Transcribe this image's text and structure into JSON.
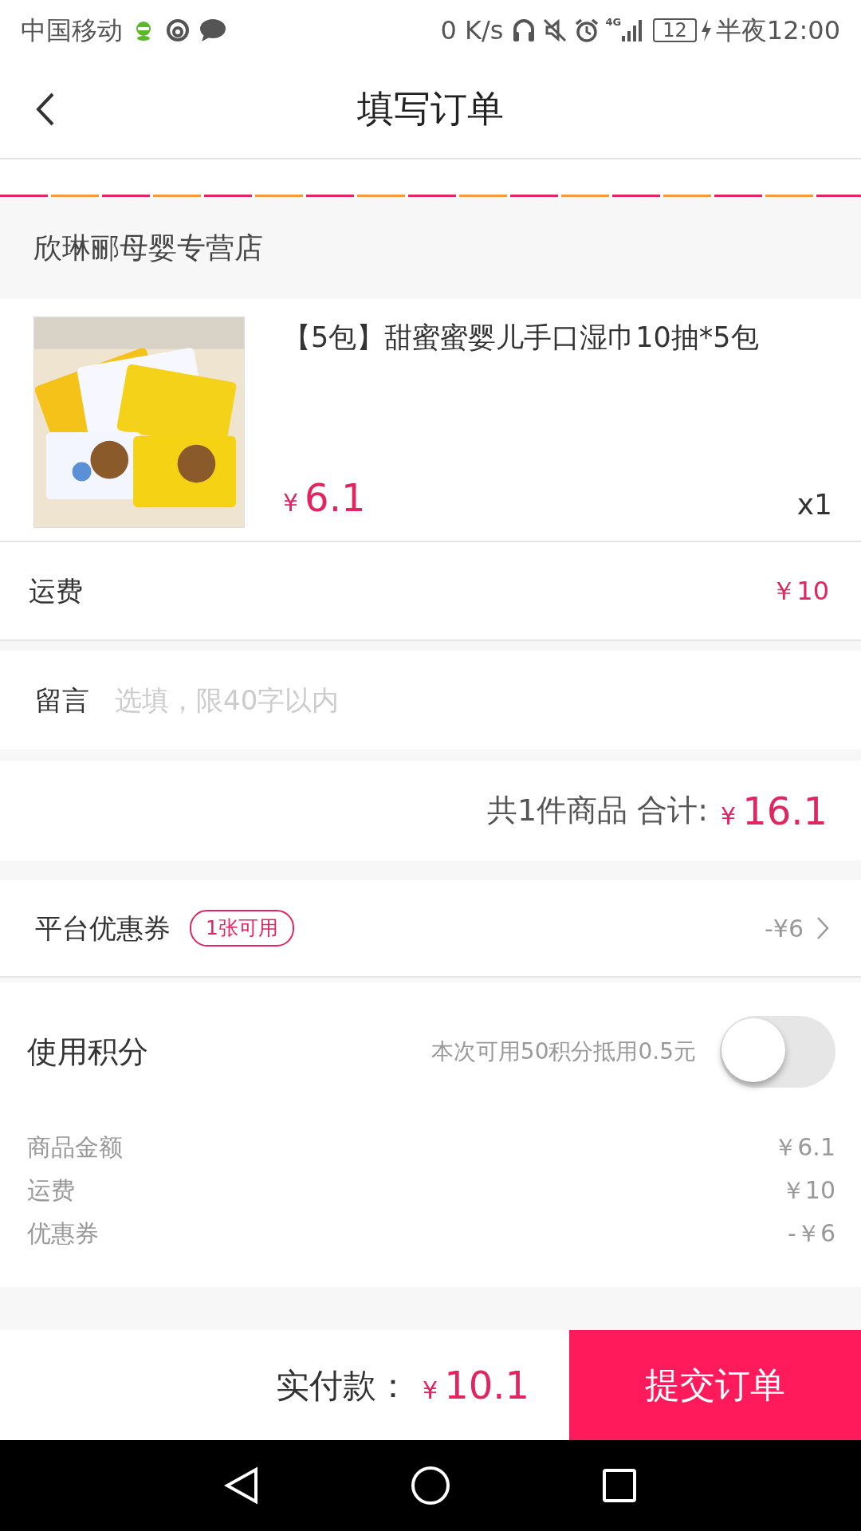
{
  "status_bar": {
    "carrier": "中国移动",
    "speed": "0 K/s",
    "network": "4G",
    "battery": "12",
    "time": "半夜12:00"
  },
  "header": {
    "title": "填写订单"
  },
  "store": {
    "name": "欣琳郦母婴专营店"
  },
  "product": {
    "title": "【5包】甜蜜蜜婴儿手口湿巾10抽*5包",
    "currency": "¥",
    "amount": "6.1",
    "quantity": "x1"
  },
  "shipping": {
    "label": "运费",
    "value": "￥10"
  },
  "message": {
    "label": "留言",
    "placeholder": "选填，限40字以内"
  },
  "total": {
    "label": "共1件商品 合计:",
    "currency": "¥",
    "amount": "16.1"
  },
  "coupon": {
    "label": "平台优惠券",
    "badge": "1张可用",
    "value": "-¥6"
  },
  "points": {
    "label": "使用积分",
    "hint": "本次可用50积分抵用0.5元",
    "on": false
  },
  "summary": [
    {
      "label": "商品金额",
      "value": "￥6.1"
    },
    {
      "label": "运费",
      "value": "￥10"
    },
    {
      "label": "优惠券",
      "value": "-￥6"
    }
  ],
  "footer": {
    "label": "实付款：",
    "currency": "¥",
    "amount": "10.1",
    "submit": "提交订单"
  }
}
